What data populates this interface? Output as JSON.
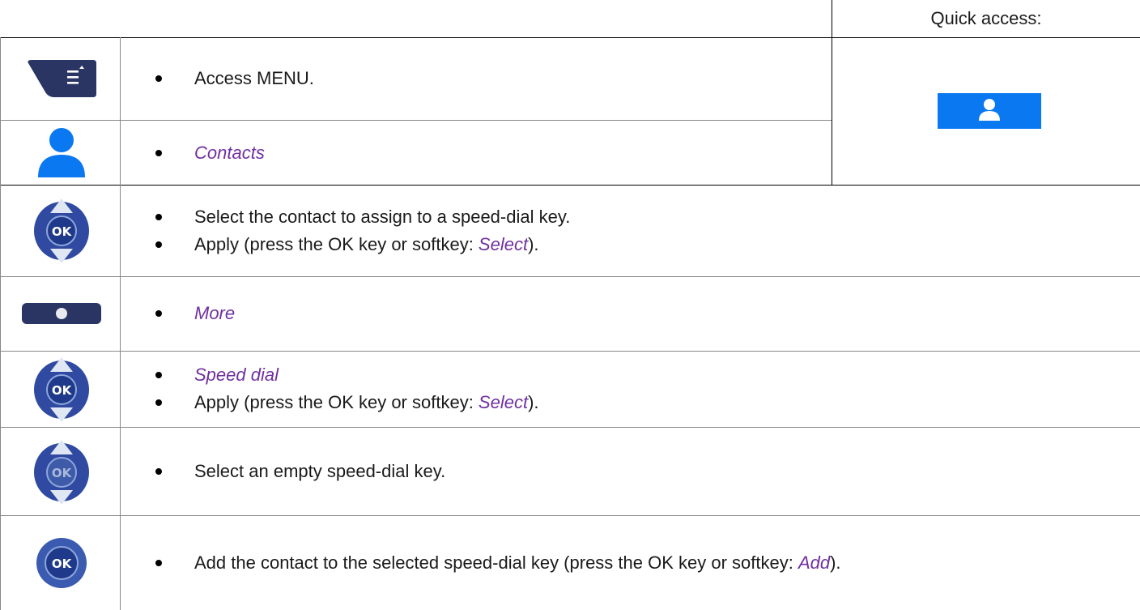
{
  "quick_access": {
    "title": "Quick access:",
    "button_icon": "contact-icon"
  },
  "steps": [
    {
      "icon": "menu-key-icon",
      "lines": [
        {
          "text": "Access MENU."
        }
      ]
    },
    {
      "icon": "contact-icon",
      "lines": [
        {
          "text": "Contacts"
        }
      ]
    },
    {
      "icon": "navigator-ok-icon",
      "lines": [
        {
          "text": "Select the contact to assign to a speed-dial key."
        },
        {
          "pre": "Apply (press the OK key or softkey: ",
          "italic": "Select",
          "post": ")."
        }
      ]
    },
    {
      "icon": "softkey-button-icon",
      "lines": [
        {
          "text": "More"
        }
      ]
    },
    {
      "icon": "navigator-ok-icon",
      "lines": [
        {
          "text": "Speed dial"
        },
        {
          "pre": "Apply (press the OK key or softkey: ",
          "italic": "Select",
          "post": ")."
        }
      ]
    },
    {
      "icon": "navigator-ok-icon",
      "lines": [
        {
          "text": "Select an empty speed-dial key."
        }
      ]
    },
    {
      "icon": "ok-button-icon",
      "lines": [
        {
          "pre": "Add the contact to the selected speed-dial key (press the OK key or softkey: ",
          "italic": "Add",
          "post": ")."
        }
      ]
    }
  ],
  "colors": {
    "italic_text": "#7030a0",
    "key_blue": "#0a78f0",
    "key_dark": "#2a3564",
    "navigator_ring": "#2f4aa0"
  }
}
